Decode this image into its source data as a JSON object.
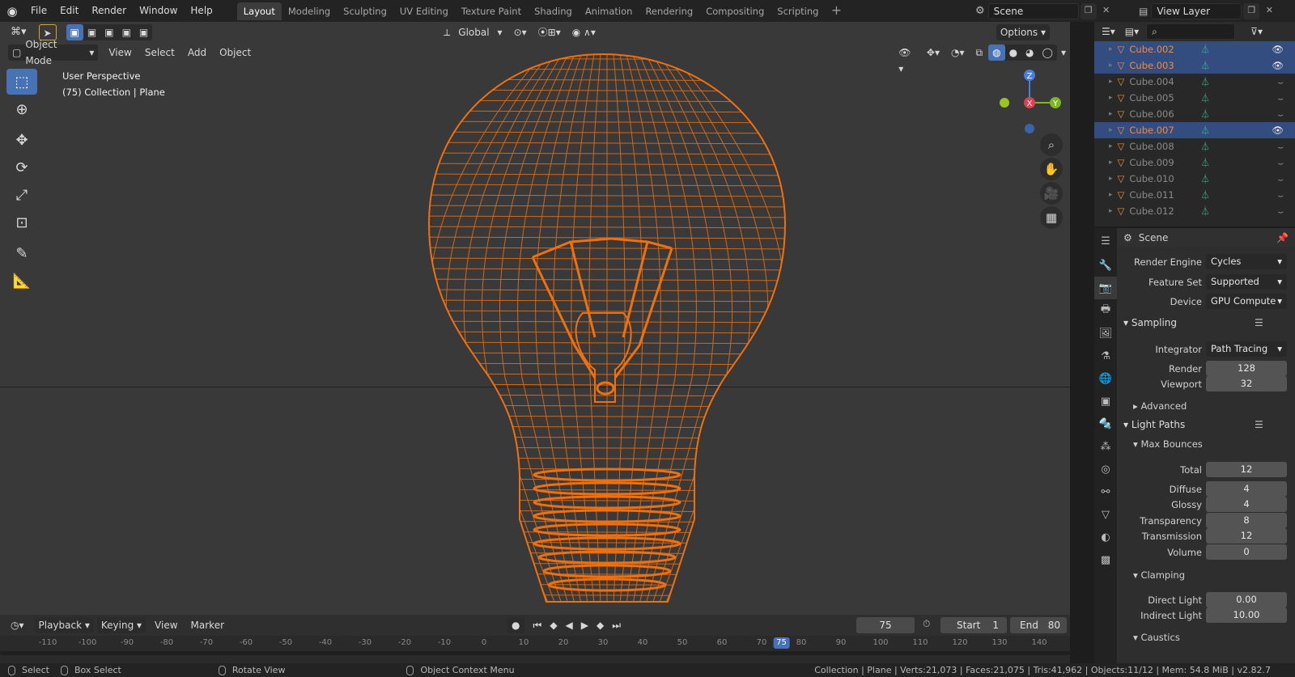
{
  "topbar": {
    "menus": [
      "File",
      "Edit",
      "Render",
      "Window",
      "Help"
    ],
    "workspaces": [
      "Layout",
      "Modeling",
      "Sculpting",
      "UV Editing",
      "Texture Paint",
      "Shading",
      "Animation",
      "Rendering",
      "Compositing",
      "Scripting"
    ],
    "active_workspace": "Layout",
    "scene": "Scene",
    "view_layer": "View Layer"
  },
  "viewport": {
    "transform_orientation": "Global",
    "mode": "Object Mode",
    "menus": [
      "View",
      "Select",
      "Add",
      "Object"
    ],
    "options_label": "Options",
    "overlay_title": "User Perspective",
    "overlay_sub": "(75) Collection | Plane",
    "gizmo_axes": {
      "z": "Z",
      "x": "X",
      "y": "Y"
    },
    "wire_color": "#f0700f"
  },
  "tools": [
    "select-box",
    "cursor",
    "move",
    "rotate",
    "scale",
    "transform",
    "annotate",
    "measure"
  ],
  "timeline": {
    "menus": [
      "Playback",
      "Keying",
      "View",
      "Marker"
    ],
    "current_frame": "75",
    "start_label": "Start",
    "start": "1",
    "end_label": "End",
    "end": "80",
    "ruler_ticks": [
      "-110",
      "-100",
      "-90",
      "-80",
      "-70",
      "-60",
      "-50",
      "-40",
      "-30",
      "-20",
      "-10",
      "0",
      "10",
      "20",
      "30",
      "40",
      "50",
      "60",
      "70",
      "75",
      "80",
      "90",
      "100",
      "110",
      "120",
      "130",
      "140"
    ]
  },
  "statusbar": {
    "select": "Select",
    "box_select": "Box Select",
    "rotate": "Rotate View",
    "context": "Object Context Menu",
    "stats": "Collection | Plane | Verts:21,073 | Faces:21,075 | Tris:41,962 | Objects:11/12 | Mem: 54.8 MiB | v2.82.7"
  },
  "outliner": {
    "items": [
      {
        "name": "Cube.002",
        "selected": true
      },
      {
        "name": "Cube.003",
        "selected": true
      },
      {
        "name": "Cube.004",
        "selected": false
      },
      {
        "name": "Cube.005",
        "selected": false
      },
      {
        "name": "Cube.006",
        "selected": false
      },
      {
        "name": "Cube.007",
        "selected": true
      },
      {
        "name": "Cube.008",
        "selected": false
      },
      {
        "name": "Cube.009",
        "selected": false
      },
      {
        "name": "Cube.010",
        "selected": false
      },
      {
        "name": "Cube.011",
        "selected": false
      },
      {
        "name": "Cube.012",
        "selected": false
      }
    ]
  },
  "properties": {
    "context": "Scene",
    "render_engine_label": "Render Engine",
    "render_engine": "Cycles",
    "feature_set_label": "Feature Set",
    "feature_set": "Supported",
    "device_label": "Device",
    "device": "GPU Compute",
    "sampling": "Sampling",
    "integrator_label": "Integrator",
    "integrator": "Path Tracing",
    "render_label": "Render",
    "render_samples": "128",
    "viewport_label": "Viewport",
    "viewport_samples": "32",
    "advanced": "Advanced",
    "light_paths": "Light Paths",
    "max_bounces": "Max Bounces",
    "total_label": "Total",
    "total": "12",
    "diffuse_label": "Diffuse",
    "diffuse": "4",
    "glossy_label": "Glossy",
    "glossy": "4",
    "transparency_label": "Transparency",
    "transparency": "8",
    "transmission_label": "Transmission",
    "transmission": "12",
    "volume_label": "Volume",
    "volume": "0",
    "clamping": "Clamping",
    "direct_label": "Direct Light",
    "direct": "0.00",
    "indirect_label": "Indirect Light",
    "indirect": "10.00",
    "caustics": "Caustics"
  }
}
